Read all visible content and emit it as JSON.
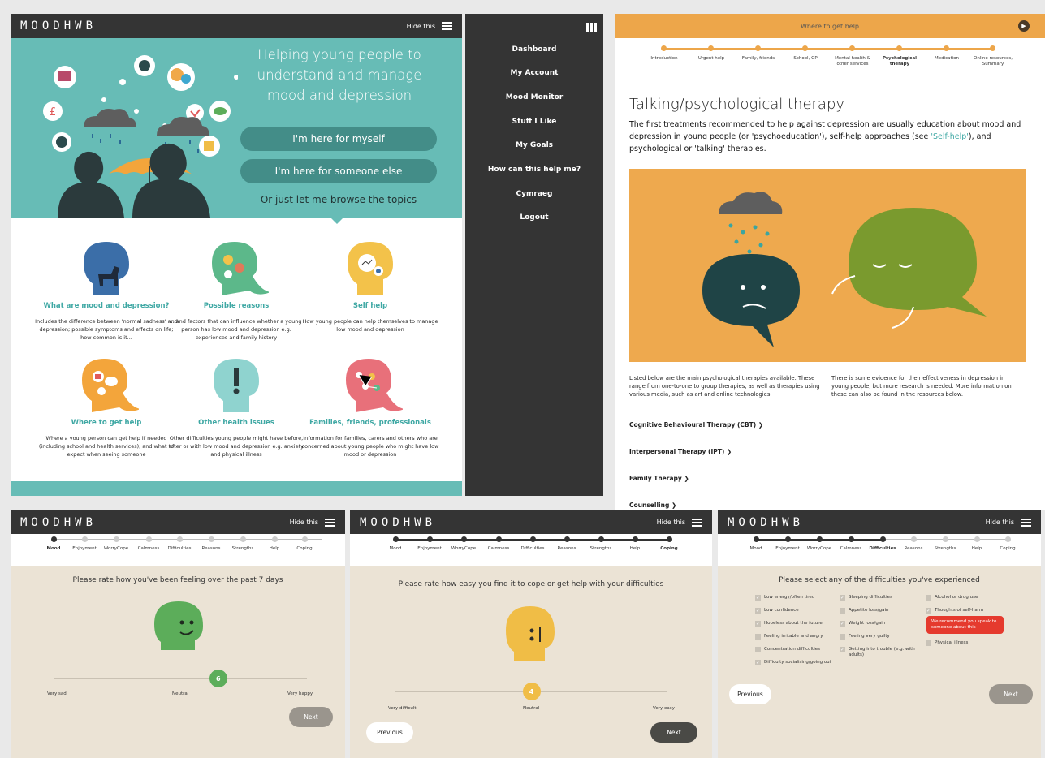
{
  "colors": {
    "teal": "#67bcb6",
    "dark": "#343434",
    "orange": "#eda64a",
    "beige": "#ebe3d5",
    "green_face": "#5cad5a",
    "yellow_face": "#f0bd46",
    "alert": "#e53a2e"
  },
  "logo": "MOODHWB",
  "header": {
    "hide_label": "Hide this"
  },
  "home": {
    "hero_title": "Helping young people to understand and manage mood and depression",
    "btn_myself": "I'm here for myself",
    "btn_someone": "I'm here for someone else",
    "browse": "Or just let me browse the topics",
    "topics": [
      {
        "title": "What are mood and depression?",
        "desc": "Includes the difference between 'normal sadness' and depression; possible symptoms and effects on life; how common is it...",
        "icon": "dog-head-icon"
      },
      {
        "title": "Possible reasons",
        "desc": "...and factors that can influence whether a young person has low mood and depression e.g. experiences and family history",
        "icon": "thoughts-head-icon"
      },
      {
        "title": "Self help",
        "desc": "How young people can help themselves to manage low mood and depression",
        "icon": "bubbles-head-icon"
      },
      {
        "title": "Where to get help",
        "desc": "Where a young person can get help if needed (including school and health services), and what to expect when seeing someone",
        "icon": "phone-head-icon"
      },
      {
        "title": "Other health issues",
        "desc": "Other difficulties young people might have before, after or with low mood and depression e.g. anxiety and physical illness",
        "icon": "exclamation-head-icon"
      },
      {
        "title": "Families, friends, professionals",
        "desc": "Information for families, carers and others who are concerned about young people who might have low mood or depression",
        "icon": "network-head-icon"
      }
    ]
  },
  "menu": {
    "items": [
      "Dashboard",
      "My Account",
      "Mood Monitor",
      "Stuff I Like",
      "My Goals",
      "How can this help me?",
      "Cymraeg",
      "Logout"
    ]
  },
  "help": {
    "bar_title": "Where to get help",
    "steps": [
      "Introduction",
      "Urgent help",
      "Family, friends",
      "School, GP",
      "Mental health & other services",
      "Psychological therapy",
      "Medication",
      "Online resources, Summary"
    ],
    "active_step": "Psychological therapy",
    "title": "Talking/psychological therapy",
    "intro_a": "The first treatments recommended to help against depression are usually education about mood and depression in young people (or 'psychoeducation'), self-help approaches (see ",
    "intro_link": "'Self-help'",
    "intro_b": "), and psychological or 'talking' therapies.",
    "col1": "Listed below are the main psychological therapies available. These range from one-to-one to group therapies, as well as therapies using various media, such as art and online technologies.",
    "col2": "There is some evidence for their effectiveness in depression in young people, but more research is needed. More information on these can also be found in the resources below.",
    "therapies": [
      "Cognitive Behavioural Therapy (CBT)",
      "Interpersonal Therapy (IPT)",
      "Family Therapy",
      "Counselling"
    ]
  },
  "steps_labels": [
    "Mood",
    "Enjoyment",
    "WorryCope",
    "Calmness",
    "Difficulties",
    "Reasons",
    "Strengths",
    "Help",
    "Coping"
  ],
  "mood": {
    "question": "Please rate how you've been feeling over the past 7 days",
    "value": "6",
    "fraction": 0.65,
    "low": "Very sad",
    "mid": "Neutral",
    "high": "Very happy",
    "next": "Next"
  },
  "cope": {
    "question": "Please rate how easy you find it to cope or get help with your difficulties",
    "value": "4",
    "fraction": 0.5,
    "low": "Very difficult",
    "mid": "Neutral",
    "high": "Very easy",
    "prev": "Previous",
    "next": "Next"
  },
  "diff": {
    "question": "Please select any of the difficulties you've experienced",
    "col1": [
      "Low energy/often tired",
      "Low confidence",
      "Hopeless about the future",
      "Feeling irritable and angry",
      "Concentration difficulties",
      "Difficulty socialising/going out"
    ],
    "col2": [
      "Sleeping difficulties",
      "Appetite loss/gain",
      "Weight loss/gain",
      "Feeling very guilty",
      "Getting into trouble (e.g. with adults)"
    ],
    "col3": [
      "Alcohol or drug use",
      "Thoughts of self-harm",
      "Physical illness"
    ],
    "warning": "We recommend you speak to someone about this",
    "prev": "Previous",
    "next": "Next"
  }
}
